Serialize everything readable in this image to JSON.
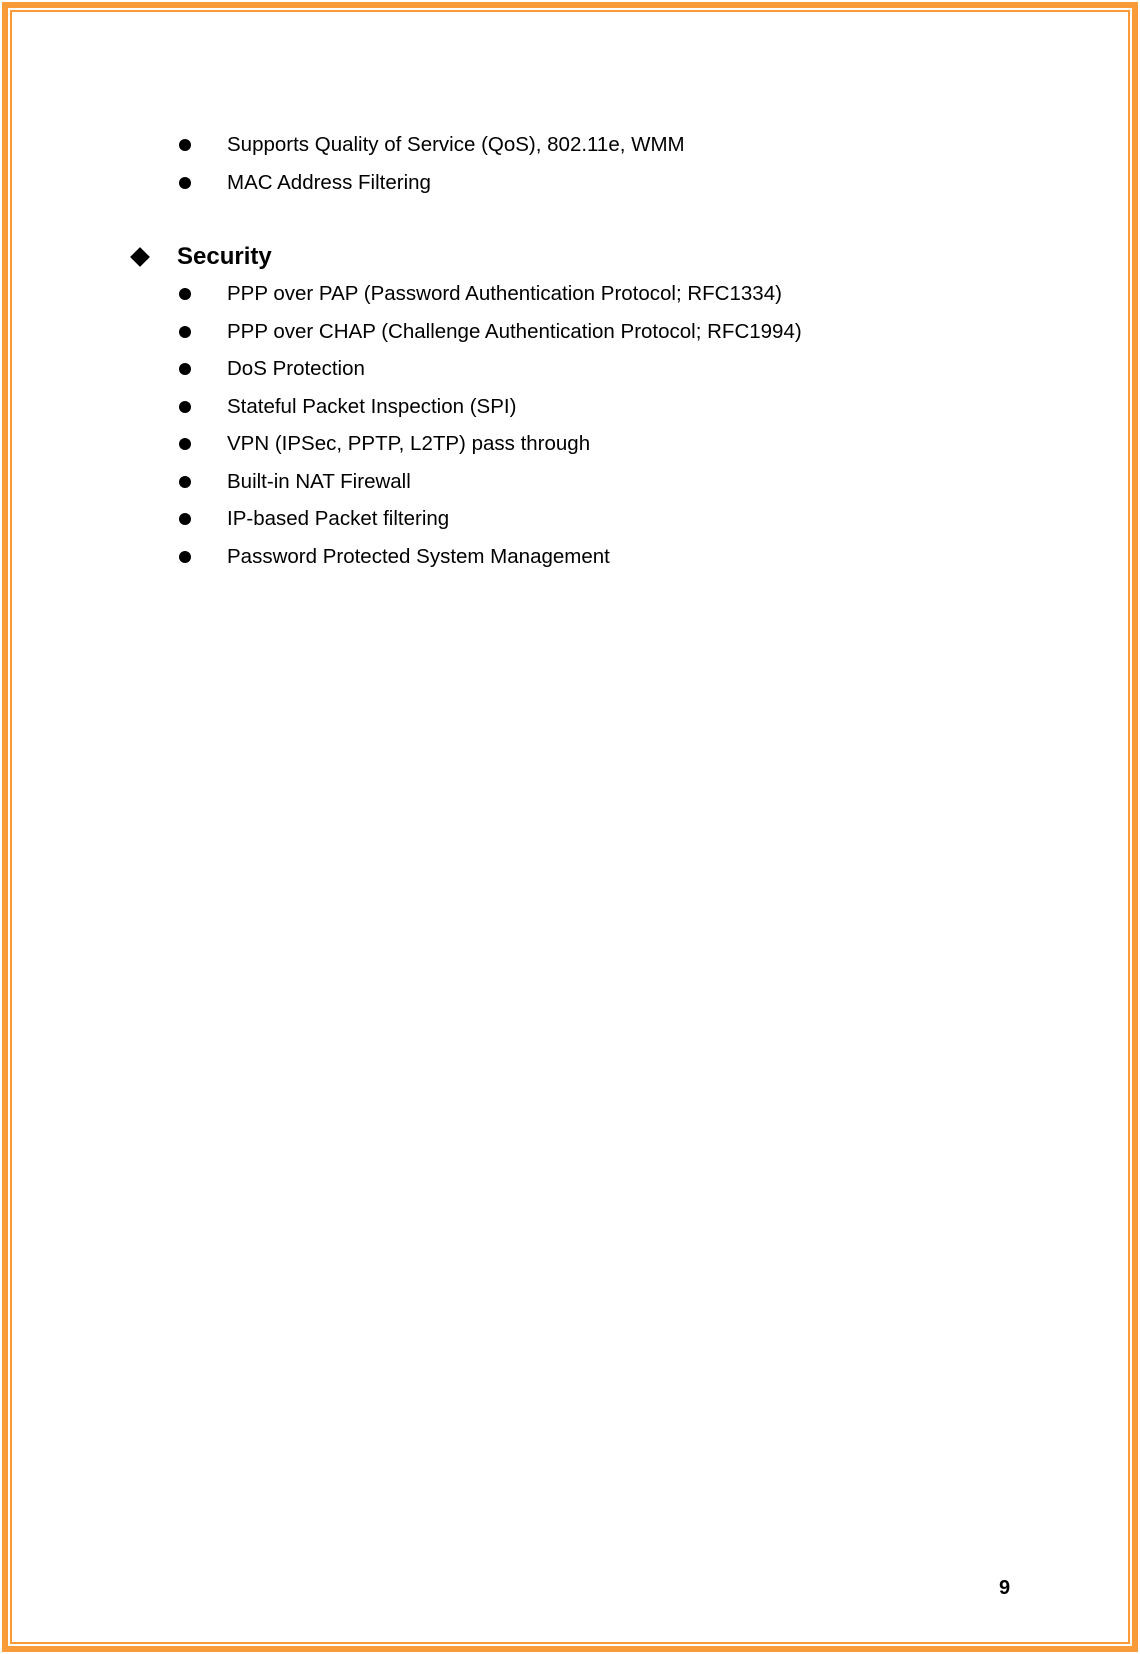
{
  "document": {
    "page_border_color": "#F99B38",
    "intro_items": [
      "Supports Quality of Service (QoS), 802.11e, WMM",
      "MAC Address Filtering"
    ],
    "section": {
      "icon": "diamond-bullet",
      "title": "Security",
      "items": [
        "PPP over PAP (Password Authentication Protocol; RFC1334)",
        "PPP over CHAP (Challenge Authentication Protocol; RFC1994)",
        "DoS Protection",
        "Stateful Packet Inspection (SPI)",
        "VPN (IPSec, PPTP, L2TP) pass through",
        "Built-in NAT Firewall",
        "IP-based Packet filtering",
        "Password Protected System Management"
      ]
    },
    "page_number": "9"
  }
}
